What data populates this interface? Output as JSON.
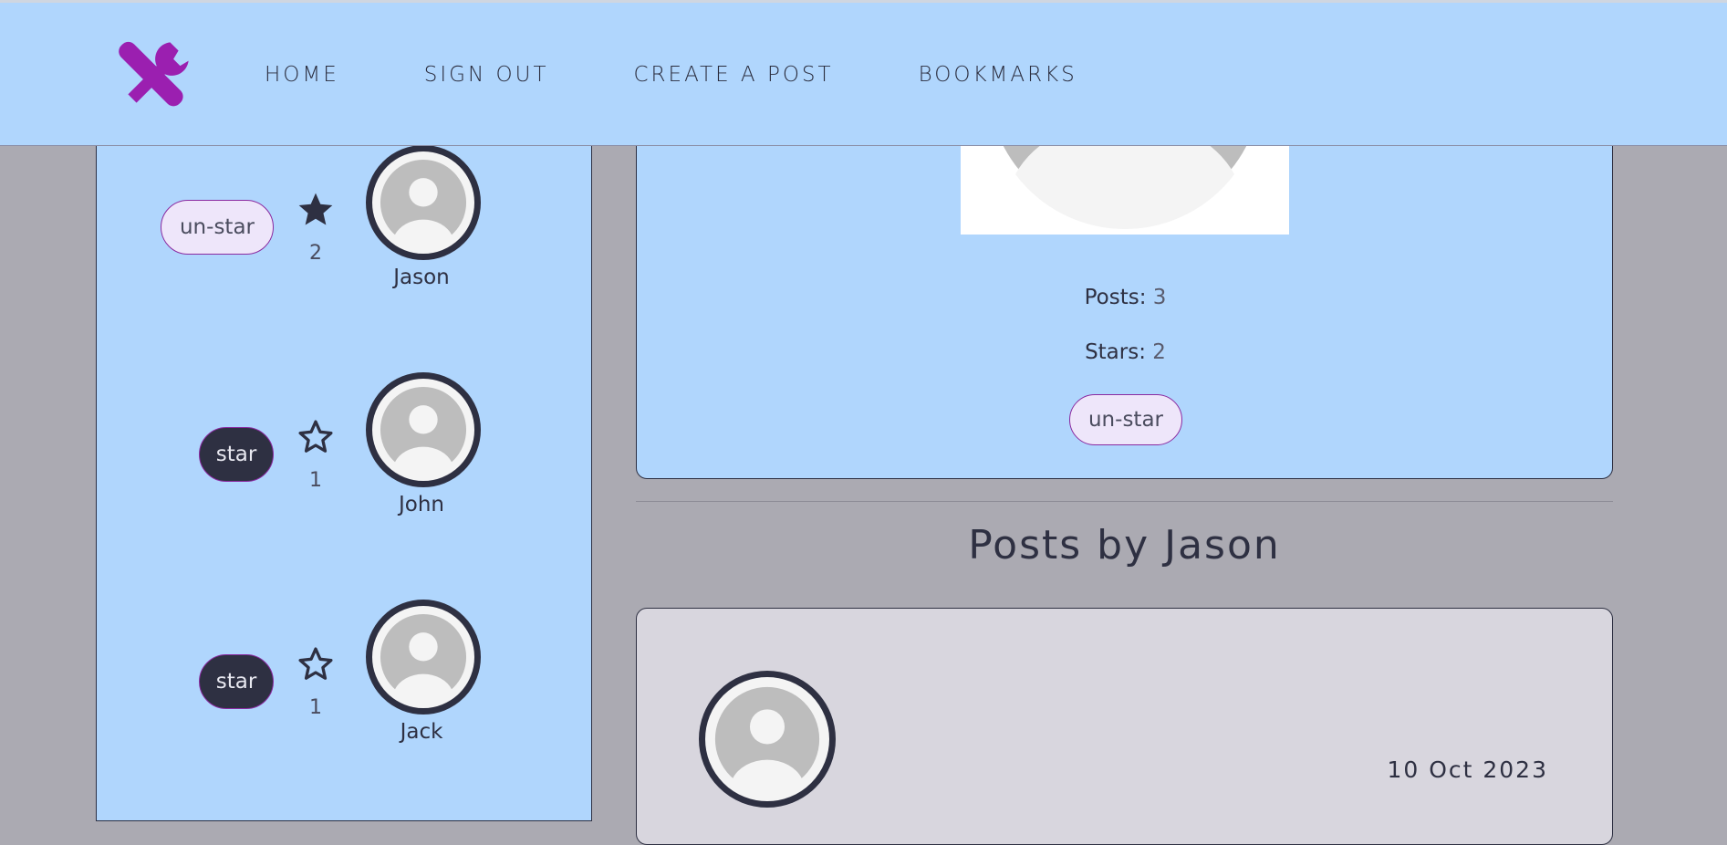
{
  "nav": {
    "logo_icon": "tools-icon",
    "items": [
      {
        "label": "HOME"
      },
      {
        "label": "SIGN OUT"
      },
      {
        "label": "CREATE A POST"
      },
      {
        "label": "BOOKMARKS"
      }
    ]
  },
  "users": [
    {
      "name": "Jason",
      "button": "un-star",
      "starred": true,
      "stars": "2"
    },
    {
      "name": "John",
      "button": "star",
      "starred": false,
      "stars": "1"
    },
    {
      "name": "Jack",
      "button": "star",
      "starred": false,
      "stars": "1"
    }
  ],
  "profile": {
    "posts_label": "Posts:",
    "posts_value": "3",
    "stars_label": "Stars:",
    "stars_value": "2",
    "button": "un-star"
  },
  "section_title": "Posts by Jason",
  "post": {
    "date": "10 Oct 2023"
  },
  "colors": {
    "header_bg": "#b0d6fd",
    "page_bg": "#abaab2",
    "accent": "#8a2aa0",
    "dark": "#2e3042"
  }
}
